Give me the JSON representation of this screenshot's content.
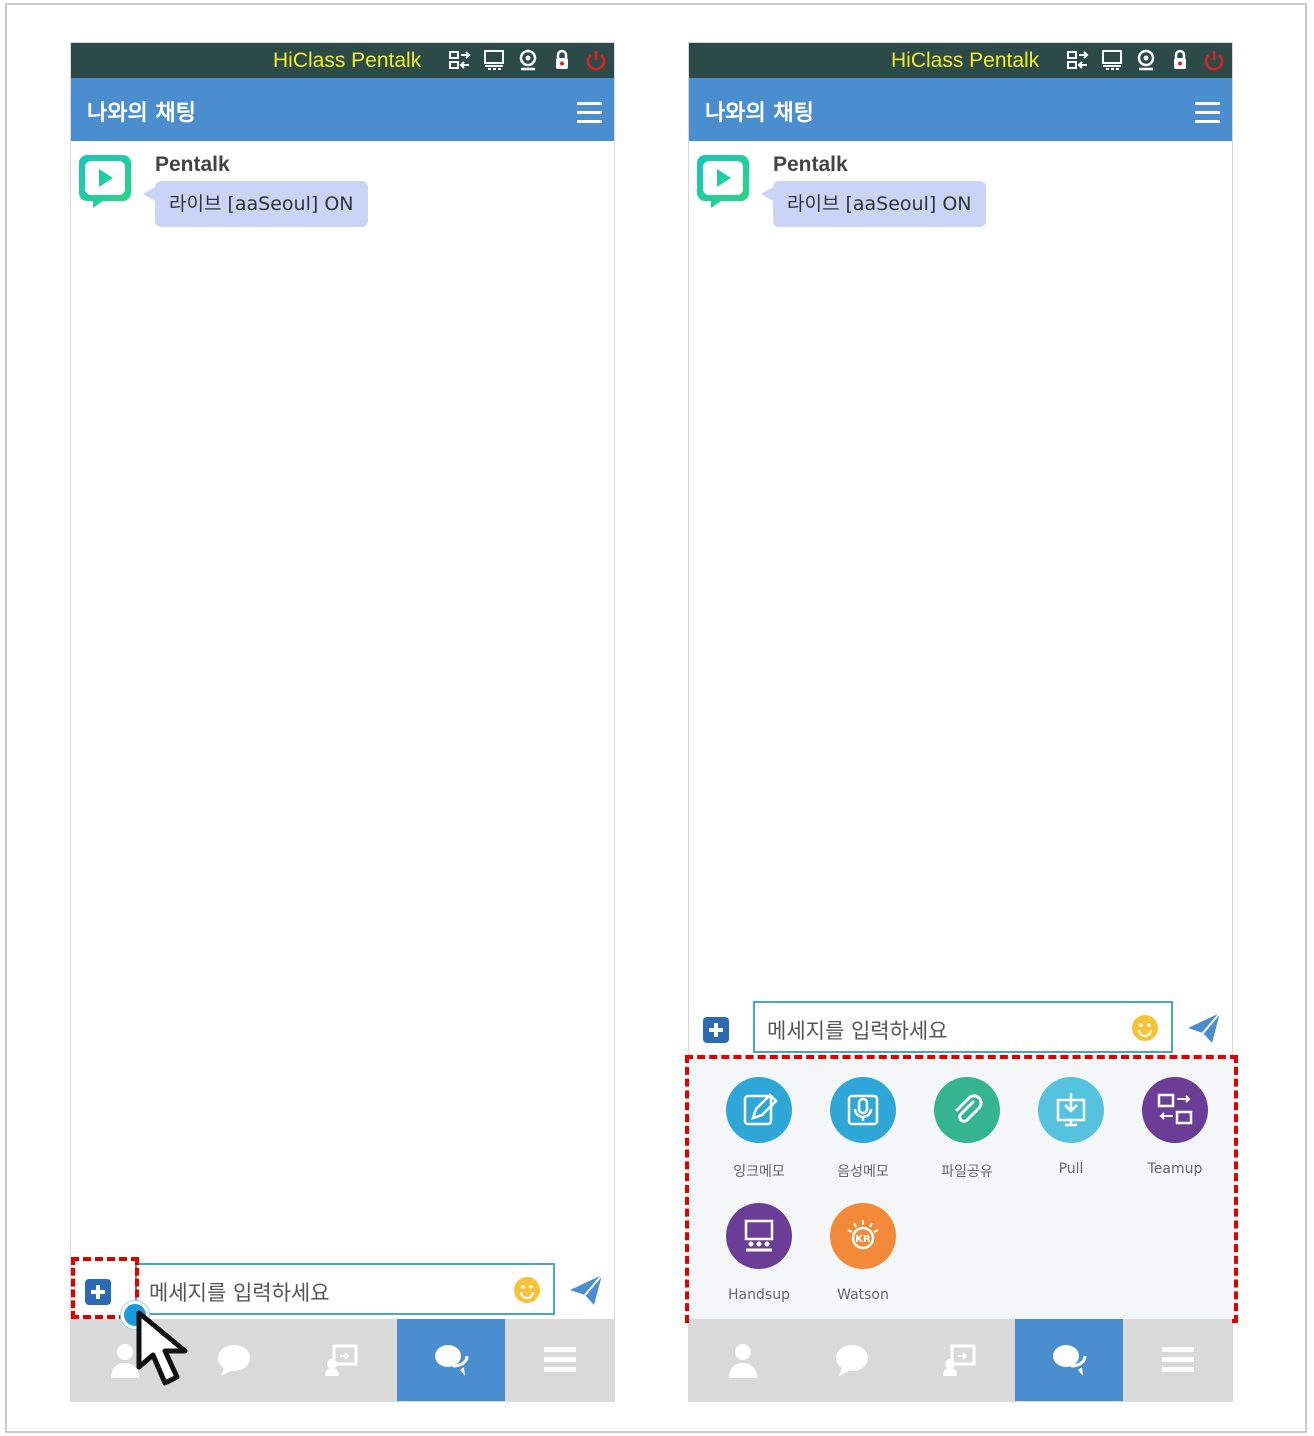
{
  "app_title": "HiClass Pentalk",
  "header_title": "나와의 채팅",
  "message": {
    "sender": "Pentalk",
    "text": "라이브 [aaSeoul] ON"
  },
  "input": {
    "placeholder": "메세지를 입력하세요"
  },
  "topbar_icons": [
    "network-icon",
    "monitor-icon",
    "webcam-icon",
    "lock-icon",
    "power-icon"
  ],
  "tabs": [
    "person-icon",
    "chat-bubble-icon",
    "screen-share-icon",
    "chat-active-icon",
    "menu-icon"
  ],
  "tools": [
    {
      "label": "잉크메모",
      "icon": "pen-memo-icon",
      "color": "#2ea7d8"
    },
    {
      "label": "음성메모",
      "icon": "microphone-icon",
      "color": "#2ea7d8"
    },
    {
      "label": "파일공유",
      "icon": "paperclip-icon",
      "color": "#35b58f"
    },
    {
      "label": "Pull",
      "icon": "pull-download-icon",
      "color": "#2ea7d8"
    },
    {
      "label": "Teamup",
      "icon": "teamup-icon",
      "color": "#6b3d96"
    },
    {
      "label": "Handsup",
      "icon": "handsup-icon",
      "color": "#6b3d96"
    },
    {
      "label": "Watson",
      "icon": "watson-icon",
      "color": "#f28a3a"
    }
  ],
  "colors": {
    "topbar": "#2c4a47",
    "title_yellow": "#f2ef2a",
    "header_blue": "#4a8ed0",
    "bubble": "#c9d4f7",
    "highlight_red": "#e00000"
  }
}
